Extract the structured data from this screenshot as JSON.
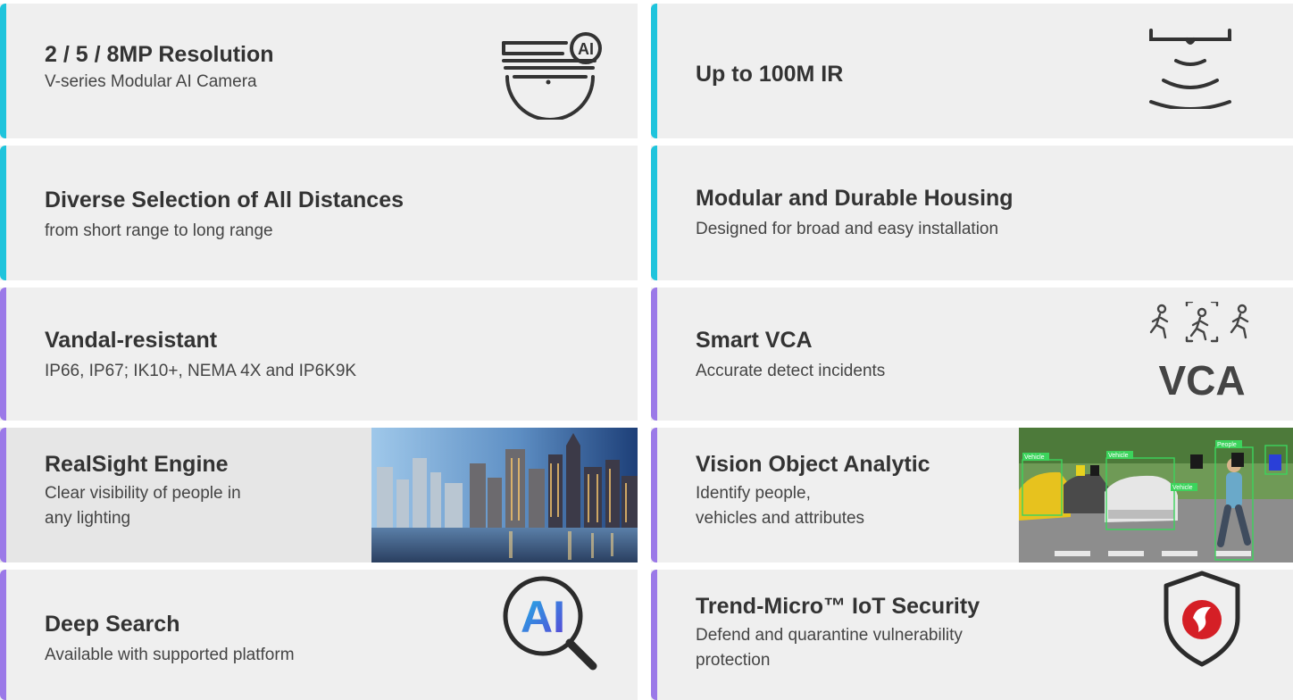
{
  "features": [
    {
      "title": "2 / 5 / 8MP Resolution",
      "sub": "V-series Modular AI Camera",
      "icon": "dome-camera-ai-icon",
      "badge": "AI",
      "accent": "#1fc4dc"
    },
    {
      "title": "Up to 100M IR",
      "sub": "",
      "icon": "ir-waves-icon",
      "accent": "#1fc4dc"
    },
    {
      "title": "Diverse Selection of All Distances",
      "sub": "from short range to long range",
      "accent": "#1fc4dc"
    },
    {
      "title": "Modular and Durable Housing",
      "sub": "Designed for broad and easy installation",
      "accent": "#1fc4dc"
    },
    {
      "title": "Vandal-resistant",
      "sub": "IP66, IP67; IK10+, NEMA 4X and IP6K9K",
      "accent": "#9b79e8"
    },
    {
      "title": "Smart VCA",
      "sub": "Accurate detect incidents",
      "icon": "vca-people-icon",
      "badge": "VCA",
      "accent": "#9b79e8"
    },
    {
      "title": "RealSight Engine",
      "sub_lines": [
        "Clear visibility of people in",
        "any lighting"
      ],
      "image": "city-skyline-photo",
      "accent": "#9b79e8"
    },
    {
      "title": "Vision Object Analytic",
      "sub_lines": [
        "Identify people,",
        "vehicles and attributes"
      ],
      "image": "street-analytics-photo",
      "tags": [
        "Vehicle",
        "Vehicle",
        "People",
        "Vehicle"
      ],
      "accent": "#9b79e8"
    },
    {
      "title": "Deep Search",
      "sub": "Available with supported platform",
      "icon": "ai-search-icon",
      "badge": "AI",
      "accent": "#9b79e8"
    },
    {
      "title": "Trend-Micro™ IoT Security",
      "sub_lines": [
        "Defend and quarantine vulnerability",
        "protection"
      ],
      "icon": "shield-trend-icon",
      "accent": "#9b79e8"
    }
  ]
}
